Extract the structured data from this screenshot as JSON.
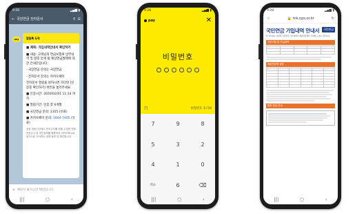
{
  "phone1": {
    "status_time": "9:50",
    "header_title": "국민연금 전자문서",
    "profile_label": "pay",
    "card_heading": "알림톡 도착",
    "lines": [
      "■ 제목: 가입내역안내서 확인하기",
      "■ 내용: 고객님의 연금보험료 납부내역 및 향후 받게 될 예상연금월액에 대한 안내문입니다.",
      "- 국민연금 문의는 국민연금",
      "- 전자문서 문의는 카카오페이",
      "전자문서 열람을 원하시면 하단의 [인증후 확인하기] 버튼을 눌러주세요.",
      "■ 인증시간: 2020/02/01 11:14 까지",
      "■ 열람기간: 인증 후 6개월",
      "■ 국민연금 문의: 1355 (유료)",
      "■ 카카오페이 문의: "
    ],
    "pay_phone": "1644-7405",
    "pay_phone_suffix": "(유료)",
    "fine_print": "공공 공동기관에서 전자고지를 위해 수집한 전화번호(CI) 등 개인정보를 활용하여 카카오톡으로 정식으로 고지하는 것에 동의 및 확인합니다.",
    "input_placeholder": "채팅이 불가능한 채널입니다."
  },
  "phone2": {
    "status_time": "9:26",
    "logo": "pay",
    "close_glyph": "✕",
    "title": "비밀번호",
    "pin_length": 6,
    "reset_label": "비밀번호 초기화",
    "keys": [
      "7",
      "9",
      "8",
      "5",
      "3",
      "2",
      "4",
      "1",
      "0",
      "취소",
      "6",
      "⌫"
    ]
  },
  "phone3": {
    "status_time": "9:28",
    "url": "mk.nps.or.kr",
    "title": "국민연금 가입내역 안내서",
    "logo": "국민연금",
    "subtitle": "본 안내서는 귀하의 국민연금 가입내역과 예상연금액을 안내해 드리는 것입니다.",
    "section1": "기본사항 및 가입내역",
    "section2": "예상연금액 설명",
    "section3": "향후 연금 안내"
  }
}
